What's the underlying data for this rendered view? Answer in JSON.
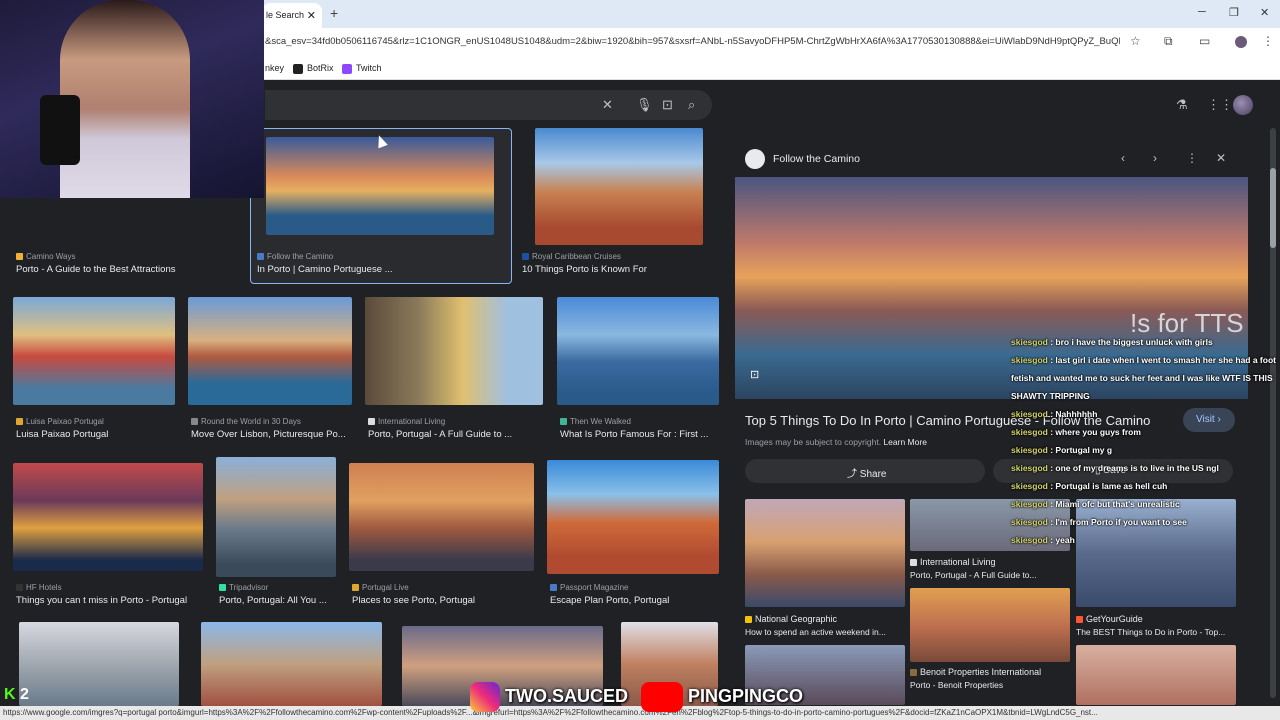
{
  "browser": {
    "tab_title": "le Search",
    "url": "&sca_esv=34fd0b0506116745&rlz=1C1ONGR_enUS1048US1048&udm=2&biw=1920&bih=957&sxsrf=ANbL-n5SavyoDFHP5M-ChrtZgWbHrXA6fA%3A1770530130888&ei=UiWlabD9NdH9ptQPyZ_BuQM&oo...",
    "bookmarks": [
      {
        "label": "nkey",
        "color": "#5a5a5a"
      },
      {
        "label": "BotRix",
        "color": "#222222"
      },
      {
        "label": "Twitch",
        "color": "#9146ff"
      }
    ],
    "status_url": "https://www.google.com/imgres?q=portugal porto&imgurl=https%3A%2F%2Ffollowthecamino.com%2Fwp-content%2Fuploads%2F...&imgrefurl=https%3A%2F%2Ffollowthecamino.com%2Fen%2Fblog%2Ftop-5-things-to-do-in-porto-camino-portugues%2F&docid=fZKaZ1nCaOPX1M&tbnid=LWgLndC5G_nst..."
  },
  "results": [
    {
      "source": "Camino Ways",
      "caption": "Porto - A Guide to the Best Attractions",
      "color": "#f2b134"
    },
    {
      "source": "Follow the Camino",
      "caption": "In Porto | Camino Portuguese ...",
      "color": "#4a79c6"
    },
    {
      "source": "Royal Caribbean Cruises",
      "caption": "10 Things Porto is Known For",
      "color": "#1f4fa0"
    },
    {
      "source": "Luisa Paixao Portugal",
      "caption": "Luisa Paixao Portugal",
      "color": "#e0a72e"
    },
    {
      "source": "Round the World in 30 Days",
      "caption": "Move Over Lisbon, Picturesque Po...",
      "color": "#888888"
    },
    {
      "source": "International Living",
      "caption": "Porto, Portugal - A Full Guide to ...",
      "color": "#dddddd"
    },
    {
      "source": "Then We Walked",
      "caption": "What Is Porto Famous For : First ...",
      "color": "#3fb59a"
    },
    {
      "source": "HF Hotels",
      "caption": "Things you can t miss in Porto - Portugal",
      "color": "#333333"
    },
    {
      "source": "Tripadvisor",
      "caption": "Porto, Portugal: All You ...",
      "color": "#34e0a1"
    },
    {
      "source": "Portugal Live",
      "caption": "Places to see Porto, Portugal",
      "color": "#e0a72e"
    },
    {
      "source": "Passport Magazine",
      "caption": "Escape Plan Porto, Portugal",
      "color": "#4a79c6"
    }
  ],
  "panel": {
    "source": "Follow the Camino",
    "title": "Top 5 Things To Do In Porto | Camino Portuguese - Follow the Camino",
    "copyright": "Images may be subject to copyright.",
    "learn_more": "Learn More",
    "visit": "Visit",
    "share": "Share",
    "save": "Save",
    "related": [
      {
        "source": "National Geographic",
        "caption": "How to spend an active weekend in..."
      },
      {
        "source": "International Living",
        "caption": "Porto, Portugal - A Full Guide to..."
      },
      {
        "source": "GetYourGuide",
        "caption": "The BEST Things to Do in Porto - Top..."
      },
      {
        "source": "Benoit Properties International",
        "caption": "Porto - Benoit Properties"
      }
    ]
  },
  "overlay": {
    "tts": "!s for TTS",
    "chat": [
      {
        "user": "skiesgod",
        "msg": "bro i have the biggest unluck with girls"
      },
      {
        "user": "skiesgod",
        "msg": "last girl i date when I went to smash her she had a foot fetish and wanted me to suck her feet and I was like WTF IS THIS SHAWTY TRIPPING"
      },
      {
        "user": "skiesgod",
        "msg": "Nahhhhhh"
      },
      {
        "user": "skiesgod",
        "msg": "where you guys from"
      },
      {
        "user": "skiesgod",
        "msg": "Portugal my g"
      },
      {
        "user": "skiesgod",
        "msg": "one of my dreams is to live in the US ngl"
      },
      {
        "user": "skiesgod",
        "msg": "Portugal is lame as hell cuh"
      },
      {
        "user": "skiesgod",
        "msg": "Miami ofc but that's unrealistic"
      },
      {
        "user": "skiesgod",
        "msg": "I'm from Porto if you want to see"
      },
      {
        "user": "skiesgod",
        "msg": "yeah"
      }
    ],
    "socials_1": "TWO.SAUCED",
    "socials_2": "PINGPINGCO",
    "kick_count": "2"
  }
}
